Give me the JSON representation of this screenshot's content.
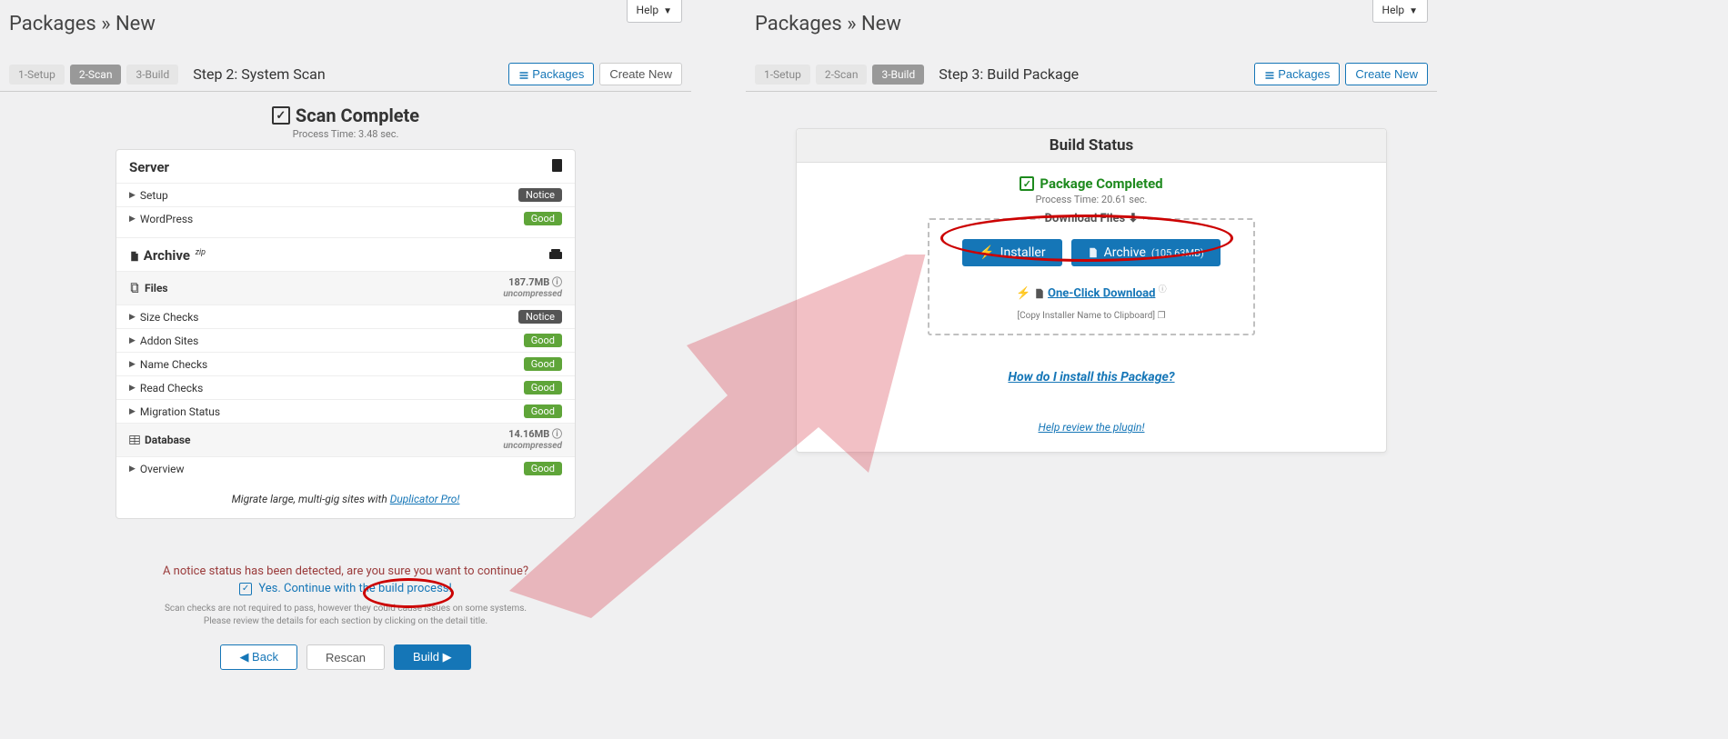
{
  "help_label": "Help",
  "page_title": "Packages » New",
  "toolbar": {
    "packages_label": "Packages",
    "create_new_label": "Create New"
  },
  "left": {
    "steps": {
      "s1": "1-Setup",
      "s2": "2-Scan",
      "s3": "3-Build"
    },
    "step_title": "Step 2: System Scan",
    "scan_complete": "Scan Complete",
    "process_time": "Process Time: 3.48 sec.",
    "server": {
      "title": "Server",
      "setup": {
        "label": "Setup",
        "status": "Notice"
      },
      "wordpress": {
        "label": "WordPress",
        "status": "Good"
      }
    },
    "archive": {
      "title": "Archive",
      "sup": "zip",
      "files": {
        "label": "Files",
        "size": "187.7MB",
        "sub": "uncompressed",
        "rows": [
          {
            "label": "Size Checks",
            "status": "Notice"
          },
          {
            "label": "Addon Sites",
            "status": "Good"
          },
          {
            "label": "Name Checks",
            "status": "Good"
          },
          {
            "label": "Read Checks",
            "status": "Good"
          },
          {
            "label": "Migration Status",
            "status": "Good"
          }
        ]
      },
      "database": {
        "label": "Database",
        "size": "14.16MB",
        "sub": "uncompressed",
        "overview": {
          "label": "Overview",
          "status": "Good"
        }
      }
    },
    "promo_pre": "Migrate large, multi-gig sites with ",
    "promo_link": "Duplicator Pro!",
    "notice_msg": "A notice status has been detected, are you sure you want to continue?",
    "notice_chk": "Yes. Continue with the build process!",
    "fine1": "Scan checks are not required to pass, however they could cause issues on some systems.",
    "fine2": "Please review the details for each section by clicking on the detail title.",
    "btn_back": "Back",
    "btn_rescan": "Rescan",
    "btn_build": "Build"
  },
  "right": {
    "steps": {
      "s1": "1-Setup",
      "s2": "2-Scan",
      "s3": "3-Build"
    },
    "step_title": "Step 3: Build Package",
    "status_head": "Build Status",
    "pkg_complete": "Package Completed",
    "process_time": "Process Time: 20.61 sec.",
    "download_title": "Download Files",
    "installer_label": "Installer",
    "archive_label": "Archive",
    "archive_size": "(105.63MB)",
    "oneclick": "One-Click Download",
    "clipboard": "[Copy Installer Name to Clipboard]",
    "install_q": "How do I install this Package?",
    "review_pre": "Help review th",
    "review_post": " plugin!"
  }
}
